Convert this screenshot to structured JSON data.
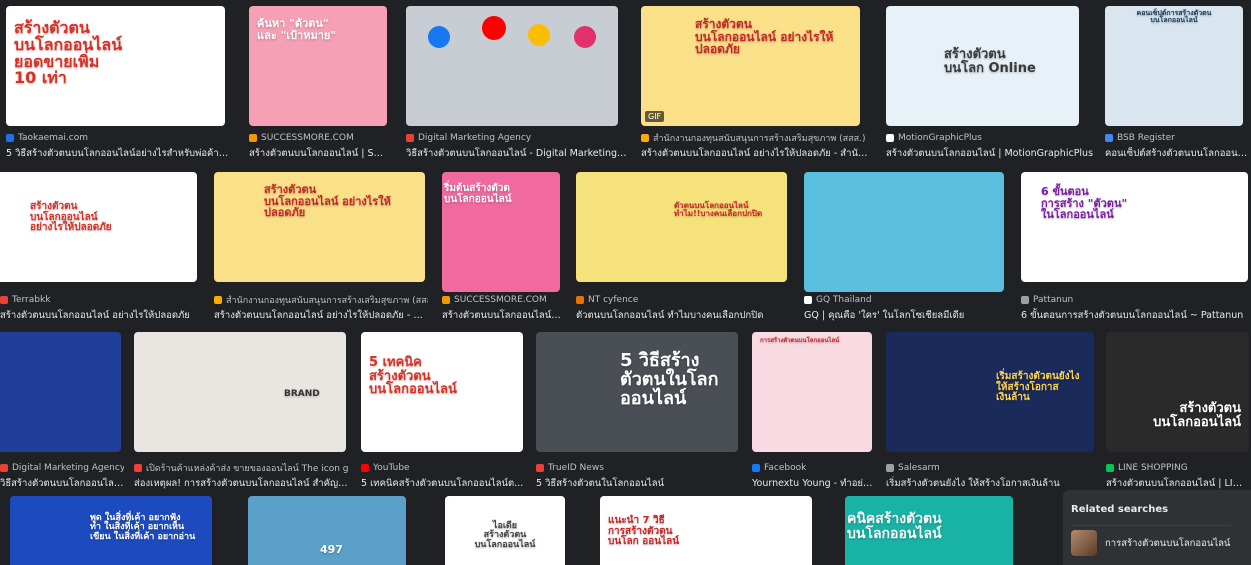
{
  "results_row1": [
    {
      "thumb_text": "สร้างตัวตน\nบนโลกออนไลน์\nยอดขายเพิ่ม\n10 เท่า",
      "source": "Taokaemai.com",
      "caption": "5 วิธีสร้างตัวตนบนโลกออนไลน์อย่างไรสำหรับพ่อค้าแม่ค้...",
      "bg": "#ffffff",
      "fg": "#d93025",
      "favicon": "#1a73e8"
    },
    {
      "thumb_text": "ค้นหา \"ตัวตน\"\nและ \"เป้าหมาย\"",
      "source": "SUCCESSMORE.COM",
      "caption": "สร้างตัวตนบนโลกออนไลน์ | SUC...",
      "bg": "#f5a0b5",
      "fg": "#ffffff",
      "favicon": "#f29900"
    },
    {
      "thumb_text": "",
      "source": "Digital Marketing Agency",
      "caption": "วิธีสร้างตัวตนบนโลกออนไลน์ - Digital Marketing A...",
      "bg": "#c8cdd4",
      "fg": "#ffffff",
      "favicon": "#ea4335"
    },
    {
      "thumb_text": "สร้างตัวตน\nบนโลกออนไลน์ อย่างไรให้ปลอดภัย",
      "source": "สำนักงานกองทุนสนับสนุนการสร้างเสริมสุขภาพ (สสส.)",
      "caption": "สร้างตัวตนบนโลกออนไลน์ อย่างไรให้ปลอดภัย - สำนัก...",
      "bg": "#fbe08a",
      "fg": "#c62828",
      "favicon": "#f9ab00",
      "gif": "GIF"
    },
    {
      "thumb_text": "สร้างตัวตน\nบนโลก Online",
      "source": "MotionGraphicPlus",
      "caption": "สร้างตัวตนบนโลกออนไลน์ | MotionGraphicPlus",
      "bg": "#e8f1f8",
      "fg": "#3a3a3a",
      "favicon": "#ffffff"
    },
    {
      "thumb_text": "คอนเซ็ปต์การสร้างตัวตน\nบนโลกออนไลน์",
      "source": "BSB Register",
      "caption": "คอนเซ็ปต์สร้างตัวตนบนโลกออนไล...",
      "bg": "#d9e6ef",
      "fg": "#1a3b5d",
      "favicon": "#4285f4"
    }
  ],
  "results_row2": [
    {
      "thumb_text": "สร้างตัวตน\nบนโลกออนไลน์\nอย่างไรให้ปลอดภัย",
      "source": "Terrabkk",
      "caption": "สร้างตัวตนบนโลกออนไลน์ อย่างไรให้ปลอดภัย",
      "bg": "#ffffff",
      "fg": "#d93025",
      "favicon": "#ea4335"
    },
    {
      "thumb_text": "สร้างตัวตน\nบนโลกออนไลน์ อย่างไรให้ปลอดภัย",
      "source": "สำนักงานกองทุนสนับสนุนการสร้างเสริมสุขภาพ (สสส.)",
      "caption": "สร้างตัวตนบนโลกออนไลน์ อย่างไรให้ปลอดภัย - สำ...",
      "bg": "#fbe08a",
      "fg": "#c62828",
      "favicon": "#f9ab00"
    },
    {
      "thumb_text": "ริ่มต้นสร้างตัวต\nบนโลกออนไลน์",
      "source": "SUCCESSMORE.COM",
      "caption": "สร้างตัวตนบนโลกออนไลน์ |...",
      "bg": "#f06aa0",
      "fg": "#ffffff",
      "favicon": "#f29900"
    },
    {
      "thumb_text": "ตัวตนบนโลกออนไลน์\nทำไม!!บางคนเลือกปกปิด",
      "source": "NT cyfence",
      "caption": "ตัวตนบนโลกออนไลน์ ทำไมบางคนเลือกปกปิด",
      "bg": "#f6e27a",
      "fg": "#c62828",
      "favicon": "#e8710a"
    },
    {
      "thumb_text": "",
      "source": "GQ Thailand",
      "caption": "GQ | คุณคือ 'ใคร' ในโลกโซเชียลมีเดีย",
      "bg": "#5bc0de",
      "fg": "#ffffff",
      "favicon": "#ffffff"
    },
    {
      "thumb_text": "6 ขั้นตอน\nการสร้าง \"ตัวตน\"\nในโลกออนไลน์",
      "source": "Pattanun",
      "caption": "6 ขั้นตอนการสร้างตัวตนบนโลกออนไลน์ ~ Pattanun",
      "bg": "#ffffff",
      "fg": "#7b1fa2",
      "favicon": "#9aa0a6"
    }
  ],
  "results_row3": [
    {
      "thumb_text": "",
      "source": "Digital Marketing Agency",
      "caption": "วิธีสร้างตัวตนบนโลกออนไลน...",
      "bg": "#1f3f9a",
      "fg": "#ffffff",
      "favicon": "#ea4335"
    },
    {
      "thumb_text": "BRAND",
      "source": "เปิดร้านค้าแหล่งค้าส่ง ขายของออนไลน์ The icon group...",
      "caption": "ส่องเหตุผล! การสร้างตัวตนบนโลกออนไลน์ สำคัญอ...",
      "bg": "#e9e6e1",
      "fg": "#333333",
      "favicon": "#ea4335"
    },
    {
      "thumb_text": "5 เทคนิค\nสร้างตัวตน\nบนโลกออนไลน์",
      "source": "YouTube",
      "caption": "5 เทคนิคสร้างตัวตนบนโลกออนไลน์ต...",
      "bg": "#ffffff",
      "fg": "#d93025",
      "favicon": "#ff0000"
    },
    {
      "thumb_text": "5 วิธีสร้าง\nตัวตนในโลก\nออนไลน์",
      "source": "TrueID News",
      "caption": "5 วิธีสร้างตัวตนในโลกออนไลน์",
      "bg": "#4a4f55",
      "fg": "#ffffff",
      "favicon": "#ea4335"
    },
    {
      "thumb_text": "การสร้างตัวตนบนโลกออนไลน์",
      "source": "Facebook",
      "caption": "Yournextu Young - ทำอย่า...",
      "bg": "#f9d9e2",
      "fg": "#c62828",
      "favicon": "#1877f2"
    },
    {
      "thumb_text": "เริ่มสร้างตัวตนยังไง\nให้สร้างโอกาส\nเงินล้าน",
      "source": "Salesarm",
      "caption": "เริ่มสร้างตัวตนยังไง ให้สร้างโอกาสเงินล้าน",
      "bg": "#1a2a5a",
      "fg": "#ffd54f",
      "favicon": "#9aa0a6"
    },
    {
      "thumb_text": "สร้างตัวตน\nบนโลกออนไลน์",
      "source": "LINE SHOPPING",
      "caption": "สร้างตัวตนบนโลกออนไลน์ | LINE...",
      "bg": "#2a2a2a",
      "fg": "#ffffff",
      "favicon": "#06c755"
    }
  ],
  "results_row4": [
    {
      "thumb_text": "พูด ในสิ่งที่เค้า อยากฟัง\nทำ ในสิ่งที่เค้า อยากเห็น\nเขียน ในสิ่งที่เค้า อยากอ่าน",
      "bg": "#1d4bbf",
      "fg": "#ffffff"
    },
    {
      "thumb_text": "497",
      "bg": "#5aa0c8",
      "fg": "#ffffff"
    },
    {
      "thumb_text": "ไอเดีย\nสร้างตัวตน\nบนโลกออนไลน์",
      "bg": "#ffffff",
      "fg": "#444444"
    },
    {
      "thumb_text": "แนะนำ 7 วิธี\nการสร้างตัวตน\nบนโลก ออนไลน์",
      "bg": "#ffffff",
      "fg": "#c62828"
    },
    {
      "thumb_text": "คนิคสร้างตัวตน\nบนโลกออนไลน์",
      "bg": "#19b3a6",
      "fg": "#ffffff"
    }
  ],
  "related": {
    "title": "Related searches",
    "item_label": "การสร้างตัวตนบนโลกออนไลน์"
  }
}
